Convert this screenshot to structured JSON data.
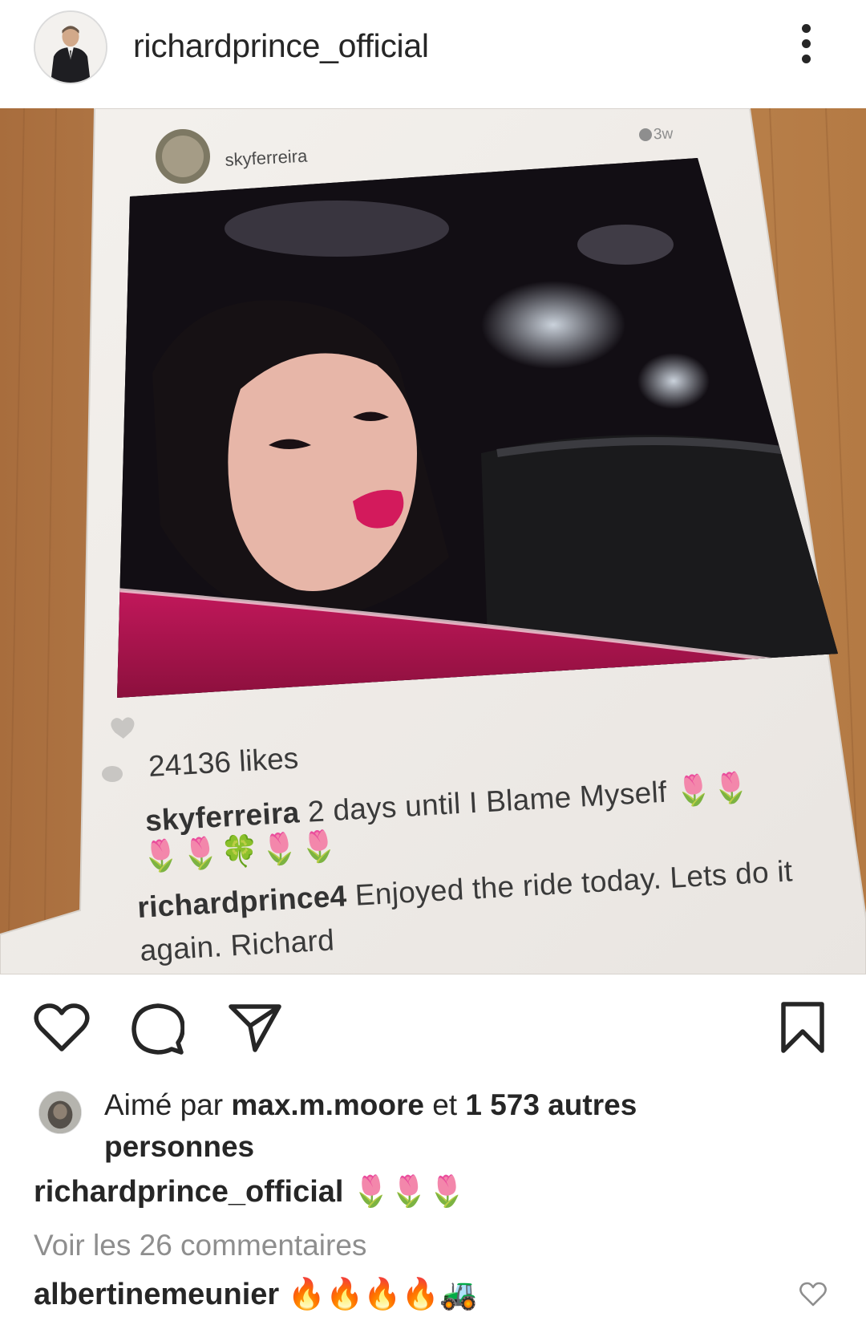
{
  "header": {
    "username": "richardprince_official",
    "more_icon": "more-vertical-icon"
  },
  "photo": {
    "inner_post": {
      "username": "skyferreira",
      "time": "3w",
      "likes": "24136 likes",
      "caption_user": "skyferreira",
      "caption_text": " 2 days until I Blame Myself 🌷🌷",
      "caption_emoji": "🌷🌷🍀🌷🌷",
      "comment_user": "richardprince4",
      "comment_text": " Enjoyed the ride today. Lets do it again. Richard"
    }
  },
  "actions": {
    "like_icon": "heart-icon",
    "comment_icon": "comment-icon",
    "share_icon": "paper-plane-icon",
    "save_icon": "bookmark-icon"
  },
  "likes": {
    "prefix": "Aimé par ",
    "user": "max.m.moore",
    "middle": " et ",
    "count": "1 573 autres personnes"
  },
  "caption": {
    "user": "richardprince_official",
    "text": " 🌷🌷🌷"
  },
  "view_comments": "Voir les 26 commentaires",
  "comment": {
    "user": "albertinemeunier",
    "text": " 🔥🔥🔥🔥🚜"
  }
}
